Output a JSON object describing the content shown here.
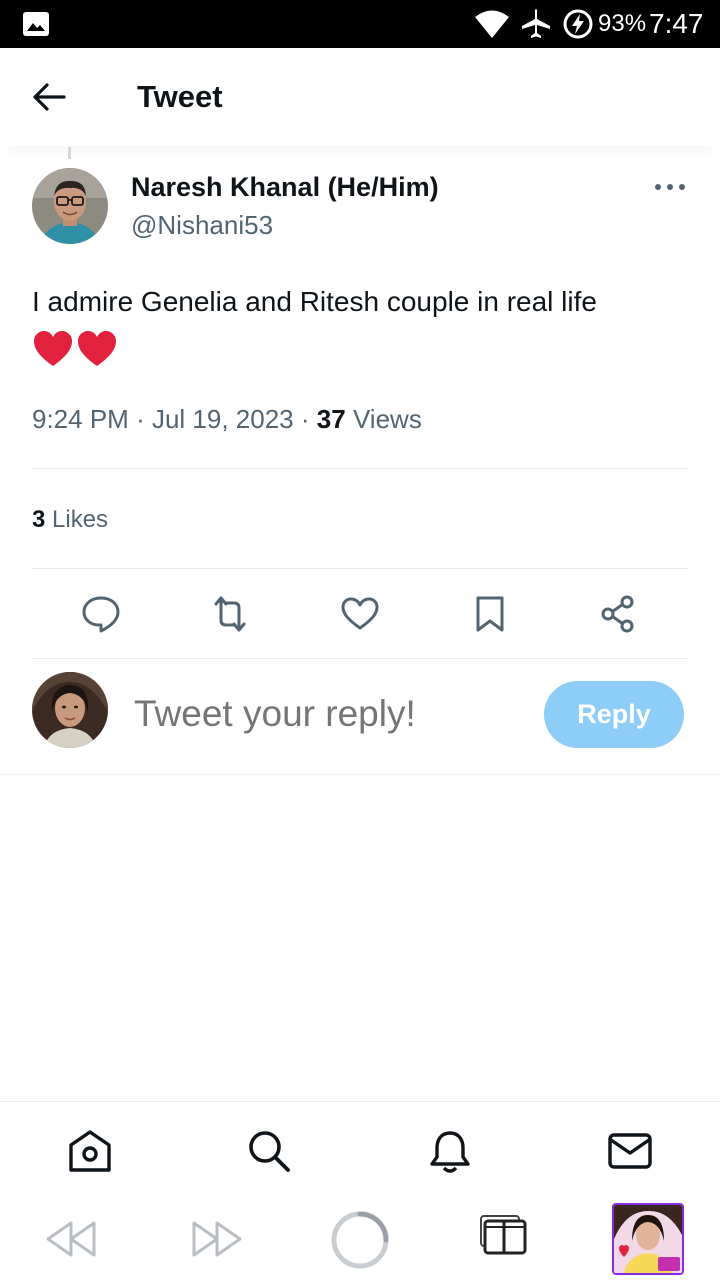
{
  "status_bar": {
    "battery_percent": "93%",
    "time": "7:47",
    "icons": [
      "image-icon",
      "wifi-icon",
      "airplane-mode-icon",
      "battery-charging-icon"
    ]
  },
  "header": {
    "title": "Tweet",
    "back_icon": "arrow-left-icon"
  },
  "tweet": {
    "author_name": "Naresh Khanal (He/Him)",
    "author_handle": "@Nishani53",
    "text": "I admire Genelia and Ritesh couple in real life",
    "emoji": "❤️❤️",
    "time": "9:24 PM",
    "date": "Jul 19, 2023",
    "separator": "·",
    "views_count": "37",
    "views_label": "Views",
    "likes_count": "3",
    "likes_label": "Likes"
  },
  "actions": [
    "comment-icon",
    "retweet-icon",
    "like-icon",
    "bookmark-icon",
    "share-icon"
  ],
  "reply": {
    "placeholder": "Tweet your reply!",
    "button_label": "Reply"
  },
  "bottom_nav": [
    "home-icon",
    "search-icon",
    "notifications-icon",
    "messages-icon"
  ],
  "browser_toolbar": [
    "rewind-icon",
    "fast-forward-icon",
    "loading-icon",
    "tabs-icon",
    "profile-thumbnail"
  ],
  "colors": {
    "text_primary": "#0f1419",
    "text_secondary": "#536471",
    "reply_button": "#8ecdf7",
    "heart": "#e0223f",
    "icon": "#536471"
  }
}
